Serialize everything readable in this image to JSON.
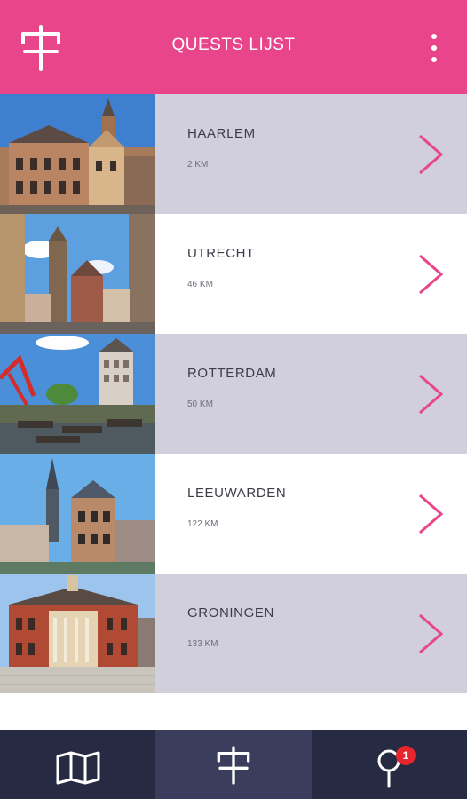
{
  "header": {
    "title": "QUESTS LIJST",
    "logo_icon": "signpost-icon",
    "menu_icon": "more-vertical-icon",
    "background": "#e8458a"
  },
  "quests": [
    {
      "name": "HAARLEM",
      "distance": "2 KM",
      "image": "haarlem-photo"
    },
    {
      "name": "UTRECHT",
      "distance": "46 KM",
      "image": "utrecht-photo"
    },
    {
      "name": "ROTTERDAM",
      "distance": "50 KM",
      "image": "rotterdam-photo"
    },
    {
      "name": "LEEUWARDEN",
      "distance": "122 KM",
      "image": "leeuwarden-photo"
    },
    {
      "name": "GRONINGEN",
      "distance": "133 KM",
      "image": "groningen-photo"
    }
  ],
  "tabs": {
    "map_icon": "map-icon",
    "quests_icon": "signpost-icon",
    "locations_icon": "map-pin-icon",
    "active": "quests",
    "badge": "1"
  },
  "colors": {
    "accent": "#e8458a",
    "row_shaded": "#d0cfdb",
    "tabbar": "#262a42",
    "tab_active": "#3a3e5c",
    "badge": "#e8242c"
  }
}
